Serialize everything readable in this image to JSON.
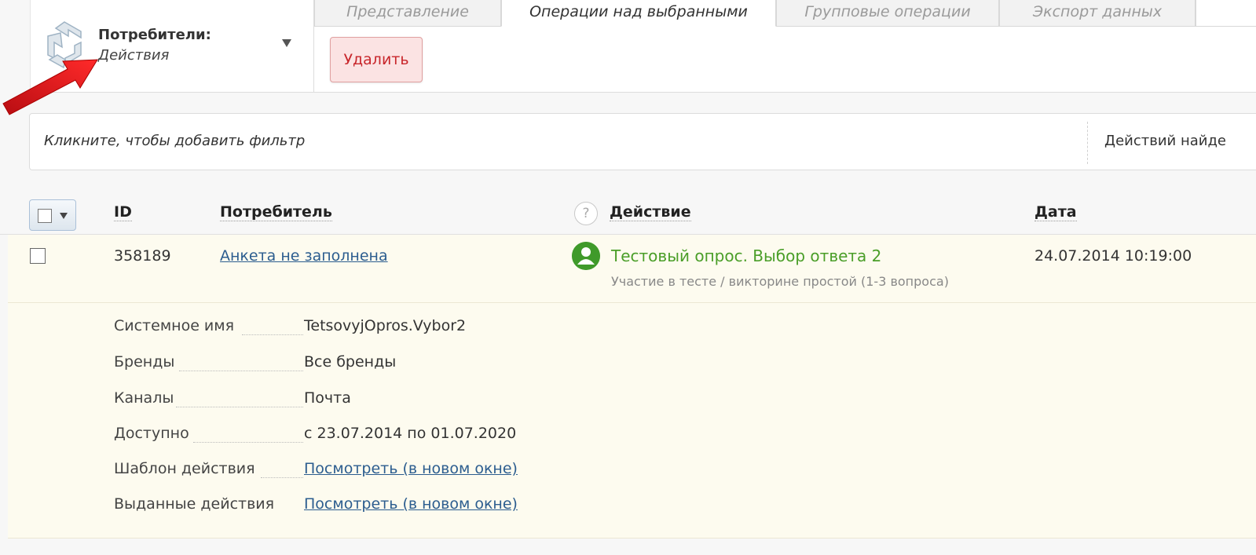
{
  "header": {
    "section_title": "Потребители:",
    "section_subtitle": "Действия",
    "logo_icon": "circular-arrows-logo",
    "dropdown_icon": "triangle-down-icon"
  },
  "tabs": [
    {
      "label": "Представление",
      "active": false
    },
    {
      "label": "Операции над выбранными",
      "active": true
    },
    {
      "label": "Групповые операции",
      "active": false
    },
    {
      "label": "Экспорт данных",
      "active": false
    }
  ],
  "toolbar": {
    "delete_label": "Удалить"
  },
  "filter": {
    "placeholder": "Кликните, чтобы добавить фильтр",
    "found_text": "Действий найде"
  },
  "table": {
    "columns": {
      "id": "ID",
      "consumer": "Потребитель",
      "help": "?",
      "action": "Действие",
      "date": "Дата"
    },
    "row": {
      "id": "358189",
      "consumer": "Анкета не заполнена",
      "action": "Тестовый опрос. Выбор ответа 2",
      "action_subtitle": "Участие в тесте / викторине простой (1-3 вопроса)",
      "date": "24.07.2014 10:19:00"
    },
    "details": [
      {
        "label": "Системное имя",
        "value": "TetsovyjOpros.Vybor2",
        "link": false
      },
      {
        "label": "Бренды",
        "value": "Все бренды",
        "link": false
      },
      {
        "label": "Каналы",
        "value": "Почта",
        "link": false
      },
      {
        "label": "Доступно",
        "value": "с 23.07.2014 по 01.07.2020",
        "link": false
      },
      {
        "label": "Шаблон действия",
        "value": "Посмотреть (в новом окне)",
        "link": true
      },
      {
        "label": "Выданные действия",
        "value": "Посмотреть (в новом окне)",
        "link": true
      }
    ]
  },
  "colors": {
    "accent_green": "#4a9e28",
    "link_blue": "#2c5d8f",
    "delete_red": "#c8262b",
    "annotation_arrow": "#e0141b"
  }
}
